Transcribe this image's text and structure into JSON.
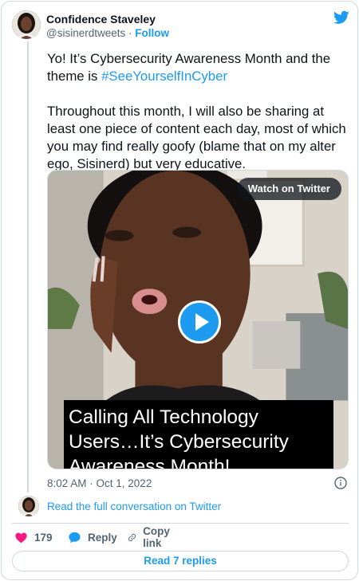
{
  "author": {
    "name": "Confidence Staveley",
    "handle": "@sisinerdtweets",
    "separator": " · ",
    "follow_label": "Follow"
  },
  "tweet": {
    "line1_text": "Yo! It’s Cybersecurity Awareness Month and the theme is ",
    "hashtag": "#SeeYourselfInCyber",
    "paragraph2": "Throughout this month, I will also be sharing at least one piece of content each day, most of which you may find really goofy (blame that on my alter ego, Sisinerd) but very educative."
  },
  "media": {
    "watch_label": "Watch on Twitter",
    "caption_lines": [
      "Calling All Technology",
      "Users…It’s Cybersecurity",
      "Awareness Month!"
    ]
  },
  "meta": {
    "timestamp": "8:02 AM · Oct 1, 2022",
    "read_conversation": "Read the full conversation on Twitter"
  },
  "actions": {
    "like_count": "179",
    "reply_label": "Reply",
    "copy_label": "Copy link",
    "read_replies": "Read 7 replies"
  },
  "colors": {
    "twitter_blue": "#1d9bf0",
    "like_red": "#f91880",
    "muted": "#536471",
    "border": "#cfd9de"
  },
  "icons": [
    "twitter-bird-icon",
    "info-icon",
    "heart-icon",
    "reply-bubble-icon",
    "link-icon",
    "play-icon"
  ]
}
